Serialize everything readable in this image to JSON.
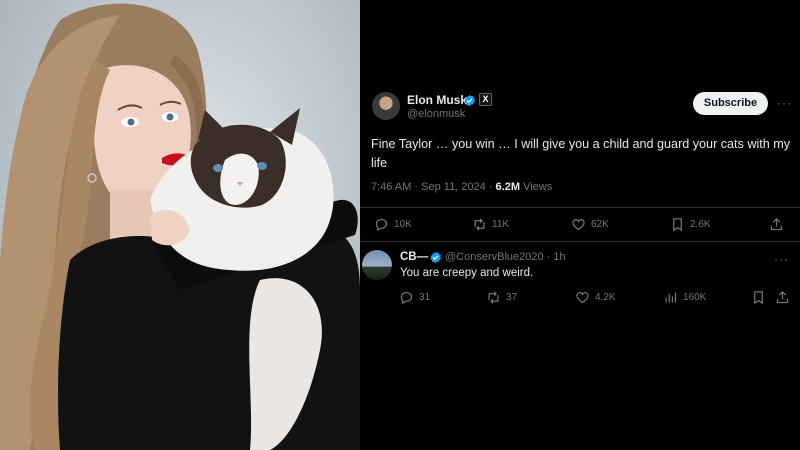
{
  "tweet": {
    "author_name": "Elon Musk",
    "author_handle": "@elonmusk",
    "affiliate_badge": "X",
    "subscribe_label": "Subscribe",
    "more_glyph": "···",
    "text": "Fine Taylor … you win … I will give you a child and guard your cats with my life",
    "time": "7:46 AM · Sep 11, 2024 · ",
    "views_count": "6.2M",
    "views_label": " Views",
    "actions": {
      "replies": "10K",
      "reposts": "11K",
      "likes": "62K",
      "bookmarks": "2.6K"
    }
  },
  "reply": {
    "author_name": "CB—",
    "author_handle": "@ConservBlue2020 · 1h",
    "more_glyph": "···",
    "text": "You are creepy and weird.",
    "actions": {
      "replies": "31",
      "reposts": "37",
      "likes": "4.2K",
      "views": "160K"
    }
  },
  "colors": {
    "background": "#000000",
    "verified_blue": "#1d9bf0",
    "secondary_text": "#71767b",
    "primary_text": "#e7e9ea"
  },
  "icons": [
    "verified-badge-icon",
    "reply-icon",
    "repost-icon",
    "like-icon",
    "bookmark-icon",
    "share-icon",
    "views-icon"
  ]
}
